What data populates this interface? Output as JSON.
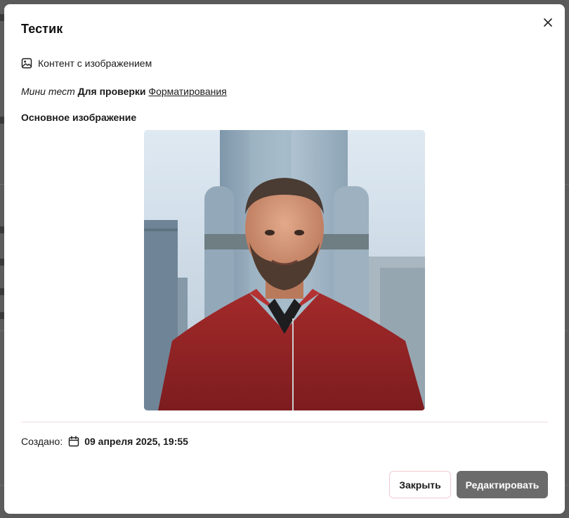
{
  "modal": {
    "title": "Тестик",
    "section_label": "Контент с изображением",
    "rich_text": {
      "italic": "Мини тест",
      "bold": "Для проверки",
      "underline": "Форматирования"
    },
    "image_label": "Основное изображение",
    "created_label": "Создано:",
    "created_value": "09 апреля 2025, 19:55",
    "buttons": {
      "close_label": "Закрыть",
      "edit_label": "Редактировать"
    }
  },
  "icons": {
    "close": "close-icon",
    "section": "image-icon",
    "date": "calendar-icon"
  },
  "colors": {
    "overlay": "#5a5a5a",
    "modal_bg": "#ffffff",
    "divider": "#f1dce0",
    "close_button_border": "#f0c9d1",
    "edit_button_bg": "#6b6b6b",
    "edit_button_text": "#ffffff"
  }
}
